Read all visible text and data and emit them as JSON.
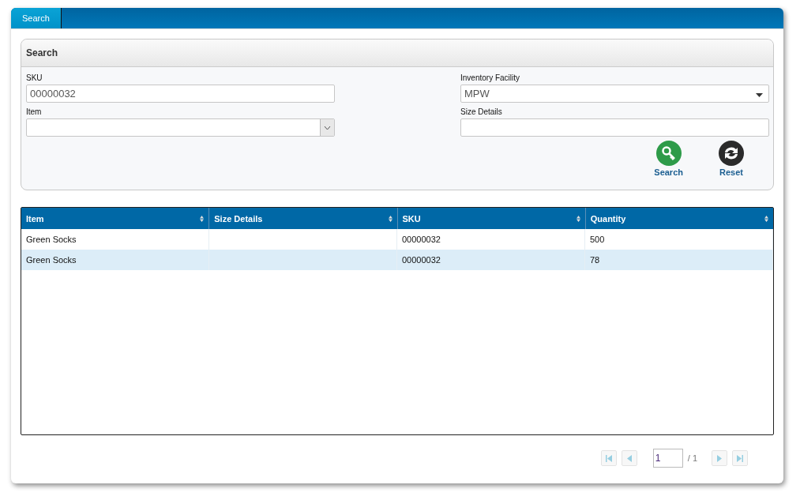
{
  "tabs": [
    {
      "label": "Search",
      "selected": true
    }
  ],
  "search_panel": {
    "title": "Search",
    "fields": [
      {
        "kind": "text",
        "label": "SKU",
        "value": "00000032"
      },
      {
        "kind": "select",
        "label": "Inventory Facility",
        "value": "MPW"
      },
      {
        "kind": "combo",
        "label": "Item"
      },
      {
        "kind": "text",
        "label": "Size Details"
      }
    ],
    "buttons": [
      {
        "kind": "search",
        "label": "Search"
      },
      {
        "kind": "reset",
        "label": "Reset"
      }
    ]
  },
  "table": {
    "columns": [
      "Item",
      "Size Details",
      "SKU",
      "Quantity"
    ],
    "rows": [
      {
        "cells": [
          "Green Socks",
          "",
          "00000032",
          "500"
        ],
        "selected": false
      },
      {
        "cells": [
          "Green Socks",
          "",
          "00000032",
          "78"
        ],
        "selected": true
      }
    ]
  },
  "pager": {
    "first_disabled": true,
    "prev_disabled": true,
    "page": "1",
    "total": "/ 1",
    "next_disabled": true,
    "last_disabled": true
  }
}
